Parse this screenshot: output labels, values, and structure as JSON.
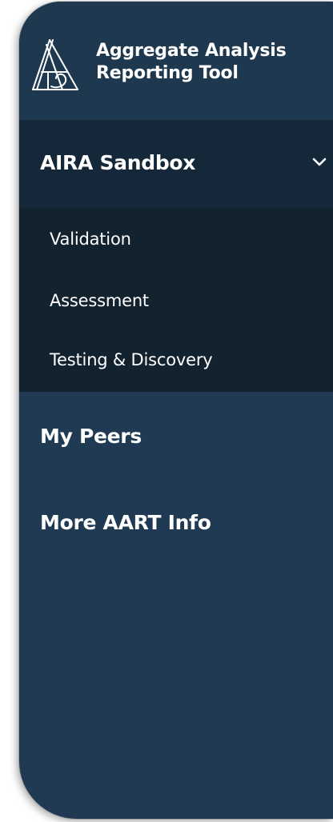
{
  "app": {
    "title_line1": "Aggregate Analysis",
    "title_line2": "Reporting Tool",
    "logo_icon": "aart-logo-icon"
  },
  "nav": {
    "active_section": {
      "label": "AIRA Sandbox",
      "expanded": true,
      "icon": "chevron-down-icon",
      "items": [
        {
          "label": "Validation"
        },
        {
          "label": "Assessment"
        },
        {
          "label": "Testing & Discovery"
        }
      ]
    },
    "items": [
      {
        "label": "My Peers"
      },
      {
        "label": "More AART Info"
      }
    ]
  },
  "colors": {
    "sidebar_bg": "#1f3a52",
    "active_section_bg": "#15283a",
    "submenu_bg": "#12222f",
    "text": "#ffffff"
  }
}
